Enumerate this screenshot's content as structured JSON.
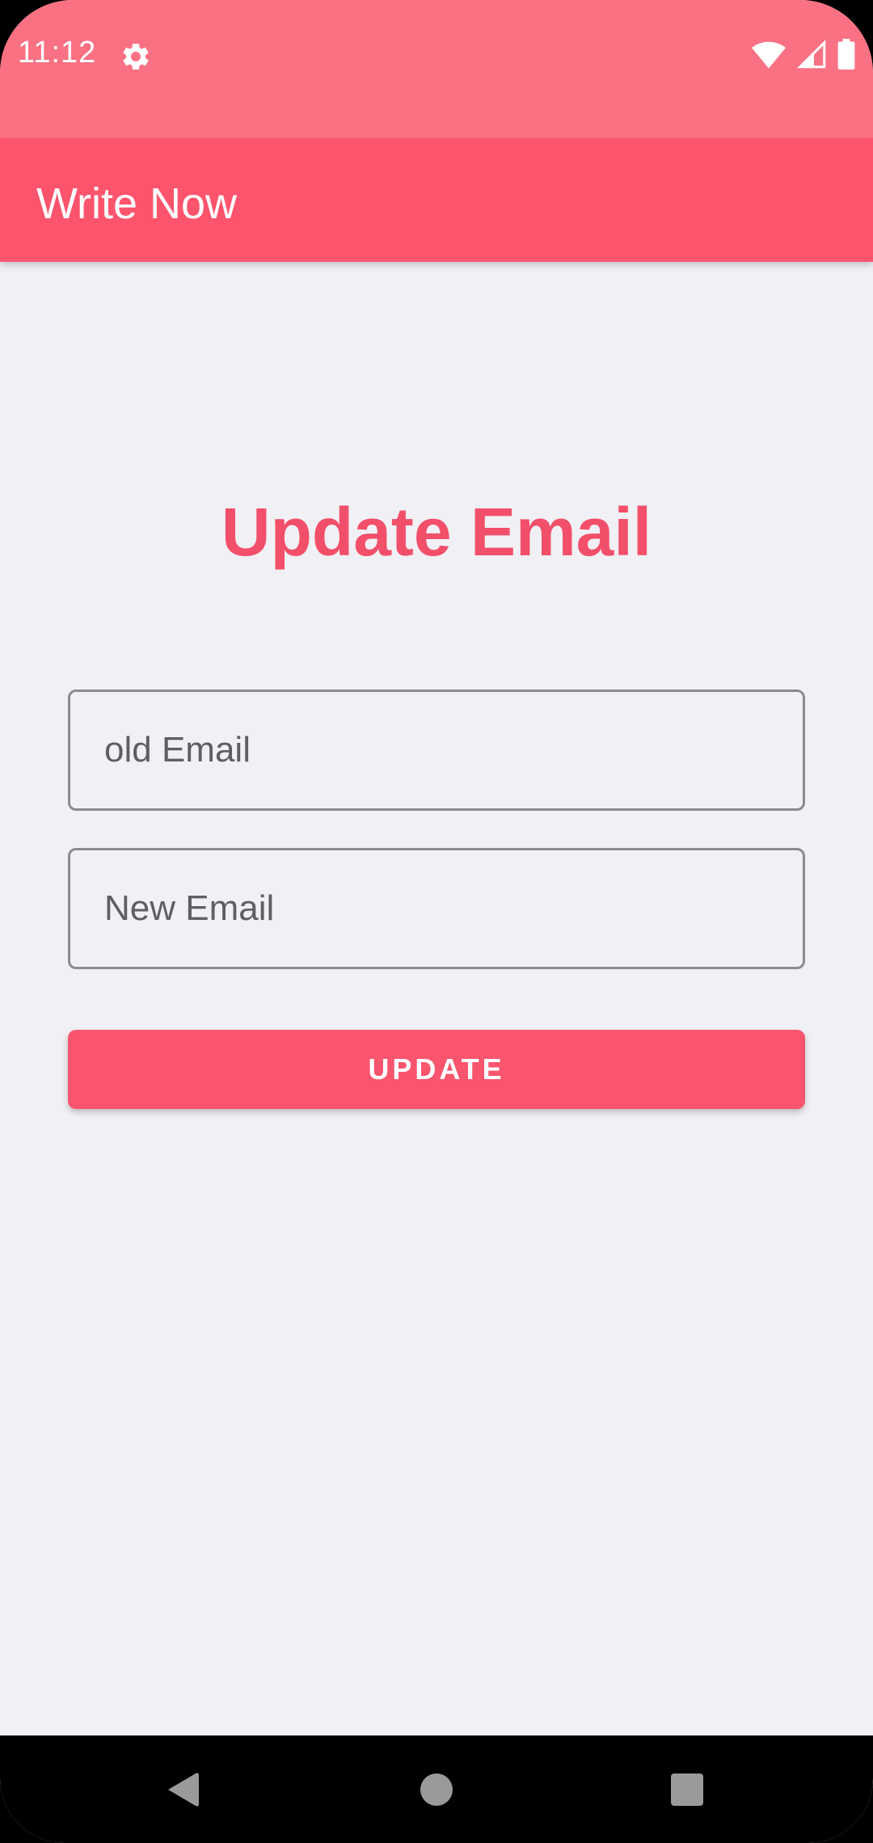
{
  "status_bar": {
    "time": "11:12",
    "icons": [
      "gear-icon",
      "wifi-icon",
      "signal-icon",
      "battery-icon"
    ]
  },
  "app_bar": {
    "title": "Write Now"
  },
  "main": {
    "heading": "Update Email",
    "old_email": {
      "placeholder": "old Email",
      "value": ""
    },
    "new_email": {
      "placeholder": "New Email",
      "value": ""
    },
    "update_button_label": "UPDATE"
  },
  "navigation_bar": {
    "buttons": [
      "back-icon",
      "home-icon",
      "recents-icon"
    ]
  },
  "colors": {
    "status_bar": "#fa7184",
    "app_bar": "#fc546d",
    "accent": "#f24f6a",
    "background": "#f1f0f5",
    "button": "#fa556e"
  }
}
